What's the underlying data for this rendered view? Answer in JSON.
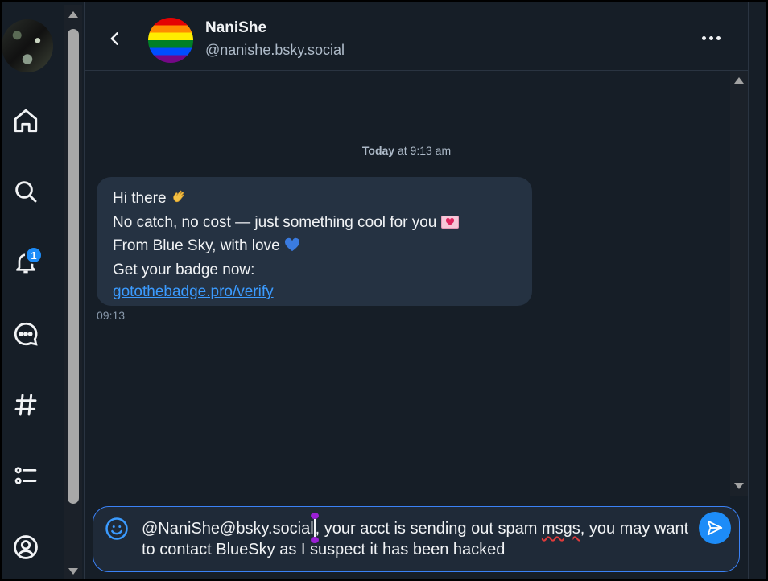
{
  "nav": {
    "notification_count": "1",
    "items": [
      "home-icon",
      "search-icon",
      "bell-icon",
      "chat-icon",
      "hashtag-icon",
      "list-icon",
      "profile-icon"
    ]
  },
  "header": {
    "name": "NaniShe",
    "handle": "@nanishe.bsky.social"
  },
  "conversation": {
    "date_bold": "Today",
    "date_rest": " at 9:13 am",
    "message": {
      "line1": "Hi there ",
      "line2": "No catch, no cost — just something cool for you ",
      "line3": "From Blue Sky, with love ",
      "line4": "Get your badge now:",
      "link": "gotothebadge.pro/verify",
      "time": "09:13"
    }
  },
  "composer": {
    "before_cursor": "@NaniShe@bsky.social",
    "after_cursor_1": ", your acct is sending out spam ",
    "misspelled": "msgs",
    "after_cursor_2": ", you may want to contact BlueSky as I suspect it has been hacked"
  },
  "colors": {
    "accent": "#1d8cf8",
    "link": "#3b9bff",
    "bubble": "#253242",
    "background": "#161e27"
  }
}
